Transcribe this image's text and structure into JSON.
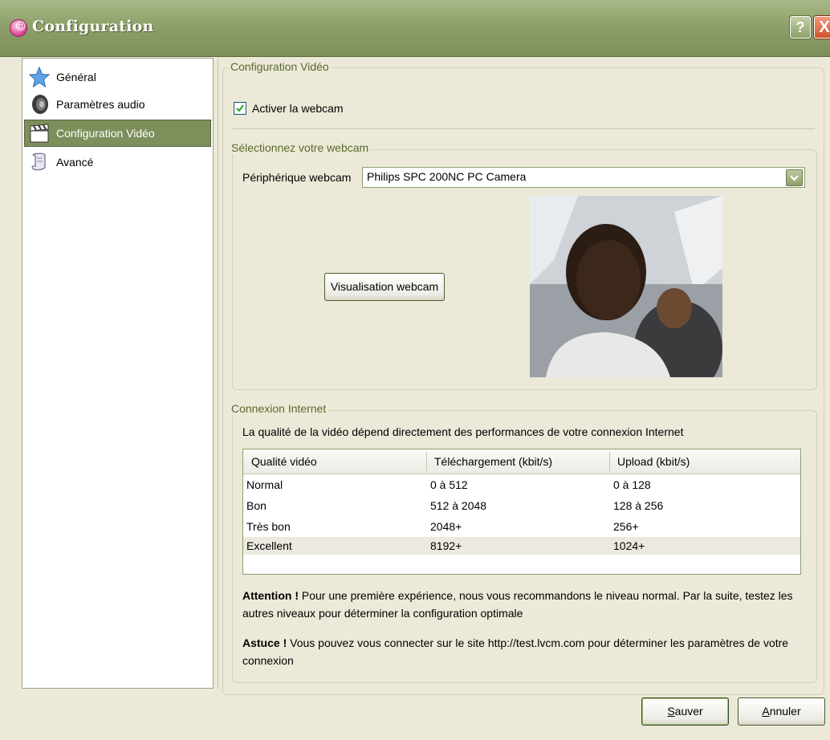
{
  "window": {
    "title": "Configuration",
    "help_label": "?",
    "close_label": "X"
  },
  "sidebar": {
    "items": [
      {
        "label": "Général",
        "icon": "star-icon"
      },
      {
        "label": "Paramètres audio",
        "icon": "speaker-icon"
      },
      {
        "label": "Configuration Vidéo",
        "icon": "clapperboard-icon",
        "selected": true
      },
      {
        "label": "Avancé",
        "icon": "scroll-icon"
      }
    ]
  },
  "video": {
    "group_title": "Configuration Vidéo",
    "enable_webcam_label": "Activer la webcam",
    "enable_webcam_checked": true
  },
  "webcam": {
    "group_title": "Sélectionnez votre webcam",
    "device_label": "Périphérique webcam",
    "device_value": "Philips SPC 200NC PC Camera",
    "preview_button": "Visualisation webcam"
  },
  "internet": {
    "group_title": "Connexion Internet",
    "description": "La qualité de la vidéo dépend directement des performances de votre connexion Internet",
    "columns": [
      "Qualité vidéo",
      "Téléchargement (kbit/s)",
      "Upload (kbit/s)"
    ],
    "rows": [
      [
        "Normal",
        "0 à 512",
        "0 à 128"
      ],
      [
        "Bon",
        "512 à 2048",
        "128 à 256"
      ],
      [
        "Très bon",
        "2048+",
        "256+"
      ],
      [
        "Excellent",
        "8192+",
        "1024+"
      ]
    ],
    "attention_bold": "Attention !",
    "attention_text": " Pour une première expérience, nous vous recommandons le niveau normal. Par la suite, testez les autres niveaux pour déterminer la configuration optimale",
    "tip_bold": "Astuce !",
    "tip_text": " Vous pouvez vous connecter sur le site http://test.lvcm.com pour déterminer les paramètres de votre connexion"
  },
  "footer": {
    "save_first": "S",
    "save_rest": "auver",
    "cancel_first": "A",
    "cancel_rest": "nnuler"
  },
  "colors": {
    "titlebar": "#8ea06a",
    "selection": "#7d8f5a",
    "group_title": "#5a6a2e"
  }
}
